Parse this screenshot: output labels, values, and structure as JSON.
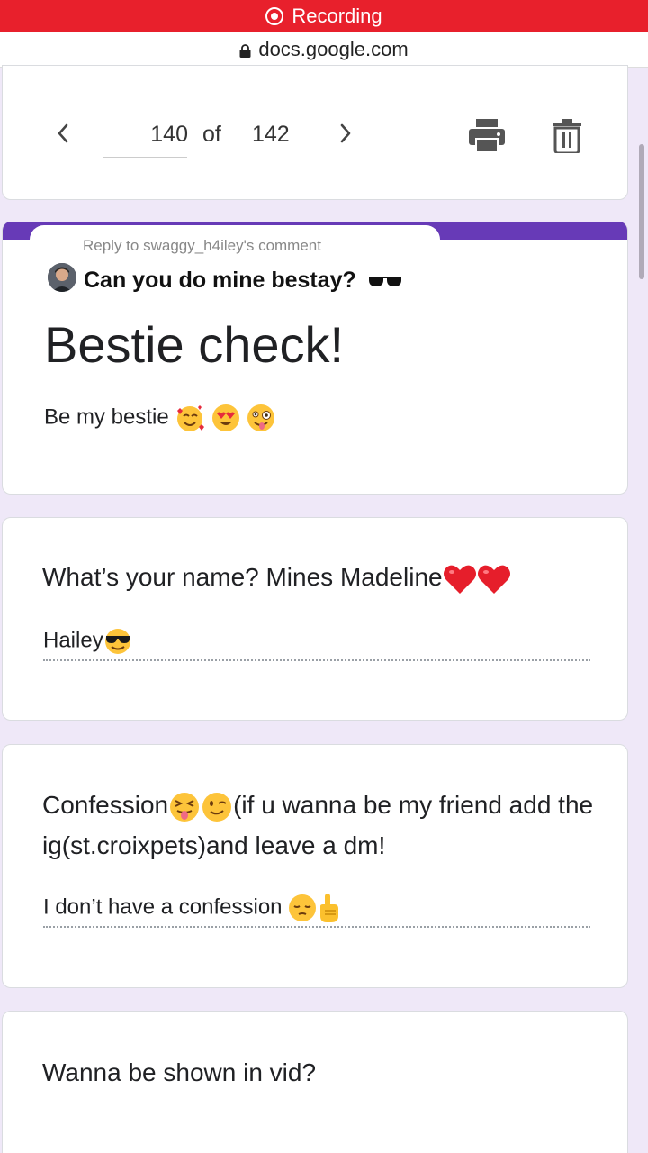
{
  "status_bar": {
    "recording_label": "Recording"
  },
  "browser": {
    "url": "docs.google.com"
  },
  "navigation": {
    "current_page": "140",
    "of_label": "of",
    "total_pages": "142"
  },
  "form_header": {
    "reply_to": "Reply to swaggy_h4iley's comment",
    "comment": "Can you do mine bestay?",
    "title": "Bestie check!",
    "description": "Be my bestie"
  },
  "questions": [
    {
      "title": "What’s your name? Mines Madeline",
      "answer": "Hailey"
    },
    {
      "title_part1": "Confession",
      "title_part2": "(if u wanna be my friend add the ig(st.croixpets)and leave a dm!",
      "answer": "I don’t have a confession"
    },
    {
      "title": "Wanna be shown in vid?"
    }
  ],
  "icons": [
    "record-icon",
    "lock-icon",
    "chevron-left-icon",
    "chevron-right-icon",
    "print-icon",
    "trash-icon",
    "sunglasses-icon",
    "smiling-face-hearts-icon",
    "heart-eyes-icon",
    "zany-face-icon",
    "red-heart-icon",
    "cool-face-icon",
    "squinting-tongue-icon",
    "winking-face-icon",
    "pensive-face-icon",
    "pointing-up-icon"
  ],
  "colors": {
    "recording_red": "#e8202c",
    "form_purple": "#673ab7",
    "page_bg": "#efe8f8"
  }
}
